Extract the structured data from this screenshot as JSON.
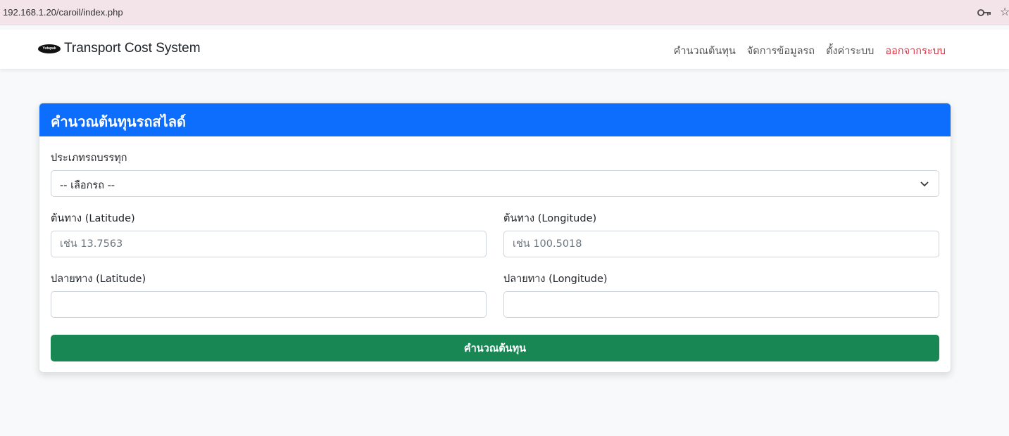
{
  "browser": {
    "url": "192.168.1.20/caroil/index.php"
  },
  "navbar": {
    "logo_text": "Yutapak",
    "brand": "Transport Cost System",
    "links": [
      "คำนวณต้นทุน",
      "จัดการข้อมูลรถ",
      "ตั้งค่าระบบ",
      "ออกจากระบบ"
    ]
  },
  "form": {
    "title": "คำนวณต้นทุนรถสไลด์",
    "vehicle_label": "ประเภทรถบรรทุก",
    "vehicle_selected": "-- เลือกรถ --",
    "origin_lat_label": "ต้นทาง (Latitude)",
    "origin_lat_placeholder": "เช่น 13.7563",
    "origin_lng_label": "ต้นทาง (Longitude)",
    "origin_lng_placeholder": "เช่น 100.5018",
    "dest_lat_label": "ปลายทาง (Latitude)",
    "dest_lng_label": "ปลายทาง (Longitude)",
    "submit_label": "คำนวณต้นทุน"
  },
  "colors": {
    "primary": "#0d6efd",
    "success": "#198754",
    "danger": "#dc3545"
  }
}
